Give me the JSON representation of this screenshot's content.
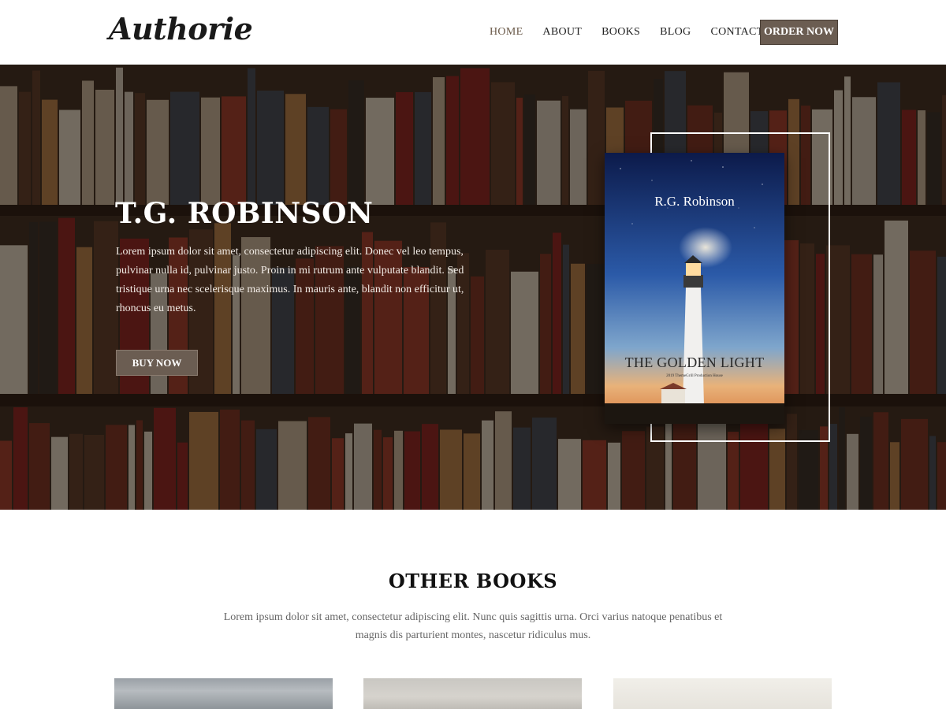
{
  "brand": {
    "logo": "Authorie"
  },
  "nav": {
    "items": [
      {
        "label": "HOME",
        "active": true
      },
      {
        "label": "ABOUT",
        "active": false
      },
      {
        "label": "BOOKS",
        "active": false
      },
      {
        "label": "BLOG",
        "active": false
      },
      {
        "label": "CONTACT",
        "active": false
      }
    ],
    "cta": "ORDER NOW"
  },
  "hero": {
    "title": "T.G. ROBINSON",
    "text": "Lorem ipsum dolor sit amet, consectetur adipiscing elit. Donec vel leo tempus, pulvinar nulla id, pulvinar justo. Proin in mi rutrum ante vulputate blandit. Sed tristique urna nec scelerisque maximus. In mauris ante, blandit non efficitur ut, rhoncus eu metus.",
    "button": "BUY NOW"
  },
  "book_cover": {
    "author": "R.G. Robinson",
    "title": "THE GOLDEN LIGHT",
    "subtitle": "2019 ThemeGrill Production House"
  },
  "other_books": {
    "title": "OTHER BOOKS",
    "text": "Lorem ipsum dolor sit amet, consectetur adipiscing elit. Nunc quis sagittis urna. Orci varius natoque penatibus et magnis dis parturient montes, nascetur ridiculus mus."
  },
  "colors": {
    "accent": "#6b5d52",
    "hero_overlay": "#140c08",
    "heading": "#111111",
    "body_text": "#666666"
  }
}
